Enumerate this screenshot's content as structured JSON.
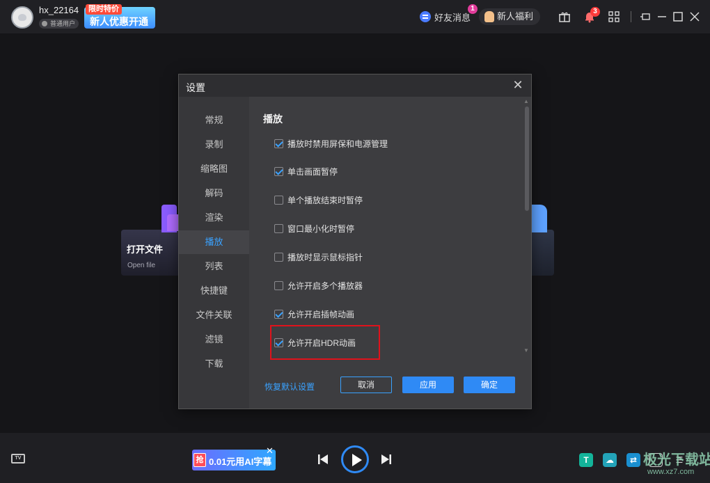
{
  "header": {
    "username": "hx_22164",
    "user_level": "普通用户",
    "promo_tag": "限时特价",
    "promo_text": "新人优惠开通",
    "friend_messages": "好友消息",
    "friend_badge": "1",
    "newbie_welfare": "新人福利",
    "notification_badge": "3"
  },
  "main": {
    "open_file_title": "打开文件",
    "open_file_sub": "Open file"
  },
  "dialog": {
    "title": "设置",
    "nav_items": [
      "常规",
      "录制",
      "缩略图",
      "解码",
      "渲染",
      "播放",
      "列表",
      "快捷键",
      "文件关联",
      "滤镜",
      "下载"
    ],
    "active_nav": "播放",
    "section_title": "播放",
    "options": [
      {
        "label": "播放时禁用屏保和电源管理",
        "checked": true
      },
      {
        "label": "单击画面暂停",
        "checked": true
      },
      {
        "label": "单个播放结束时暂停",
        "checked": false
      },
      {
        "label": "窗口最小化时暂停",
        "checked": false
      },
      {
        "label": "播放时显示鼠标指针",
        "checked": false
      },
      {
        "label": "允许开启多个播放器",
        "checked": false
      },
      {
        "label": "允许开启插帧动画",
        "checked": true
      },
      {
        "label": "允许开启HDR动画",
        "checked": true
      }
    ],
    "restore_defaults": "恢复默认设置",
    "cancel": "取消",
    "apply": "应用",
    "ok": "确定"
  },
  "bottom": {
    "tv_label": "TV",
    "ad_tag": "抢",
    "ad_text": "0.01元用AI字幕",
    "watermark_title": "极光下载站",
    "watermark_url": "www.xz7.com"
  },
  "colors": {
    "accent": "#2f8af5",
    "link": "#3aa2ff",
    "highlight_box": "#e0121b",
    "dialog_bg": "#3d3d40"
  }
}
